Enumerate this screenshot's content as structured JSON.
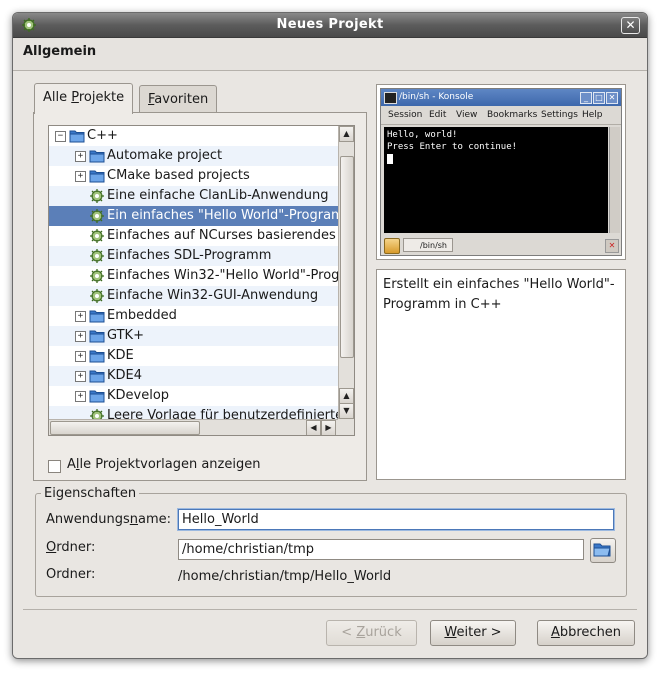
{
  "window": {
    "title": "Neues Projekt"
  },
  "header": {
    "section_title": "Allgemein"
  },
  "tabs": [
    {
      "label_pre": "Alle ",
      "label_key": "P",
      "label_post": "rojekte"
    },
    {
      "label_pre": "",
      "label_key": "F",
      "label_post": "avoriten"
    }
  ],
  "tree": {
    "items": [
      {
        "label": "C++",
        "level": 0,
        "expander": "−",
        "icon": "folder-open-icon"
      },
      {
        "label": "Automake project",
        "level": 1,
        "expander": "+",
        "icon": "folder-icon"
      },
      {
        "label": "CMake based projects",
        "level": 1,
        "expander": "+",
        "icon": "folder-icon"
      },
      {
        "label": "Eine einfache ClanLib-Anwendung",
        "level": 1,
        "expander": "",
        "icon": "gear-icon"
      },
      {
        "label": "Ein einfaches \"Hello World\"-Program",
        "level": 1,
        "expander": "",
        "icon": "gear-icon",
        "selected": true
      },
      {
        "label": "Einfaches auf NCurses basierendes",
        "level": 1,
        "expander": "",
        "icon": "gear-icon"
      },
      {
        "label": "Einfaches SDL-Programm",
        "level": 1,
        "expander": "",
        "icon": "gear-icon"
      },
      {
        "label": "Einfaches Win32-\"Hello World\"-Prog",
        "level": 1,
        "expander": "",
        "icon": "gear-icon"
      },
      {
        "label": "Einfache Win32-GUI-Anwendung",
        "level": 1,
        "expander": "",
        "icon": "gear-icon"
      },
      {
        "label": "Embedded",
        "level": 1,
        "expander": "+",
        "icon": "folder-icon"
      },
      {
        "label": "GTK+",
        "level": 1,
        "expander": "+",
        "icon": "folder-icon"
      },
      {
        "label": "KDE",
        "level": 1,
        "expander": "+",
        "icon": "folder-icon"
      },
      {
        "label": "KDE4",
        "level": 1,
        "expander": "+",
        "icon": "folder-icon"
      },
      {
        "label": "KDevelop",
        "level": 1,
        "expander": "+",
        "icon": "folder-icon"
      },
      {
        "label": "Leere Vorlage für benutzerdefinierte",
        "level": 1,
        "expander": "",
        "icon": "gear-icon"
      }
    ]
  },
  "show_all": {
    "label_pre": "A",
    "label_key": "l",
    "label_post": "le Projektvorlagen anzeigen",
    "checked": false
  },
  "preview": {
    "title": "/bin/sh - Konsole",
    "menu": [
      "Session",
      "Edit",
      "View",
      "Bookmarks",
      "Settings",
      "Help"
    ],
    "terminal_lines": [
      "Hello, world!",
      "Press Enter to continue!"
    ],
    "tab_label": "/bin/sh"
  },
  "description": "Erstellt ein einfaches \"Hello World\"-Programm in C++",
  "properties": {
    "title": "Eigenschaften",
    "app_name_label_pre": "Anwendungs",
    "app_name_label_key": "n",
    "app_name_label_post": "ame:",
    "app_name_value": "Hello_World",
    "folder_label_pre": "",
    "folder_label_key": "O",
    "folder_label_post": "rdner:",
    "folder_value": "/home/christian/tmp",
    "final_folder_label": "Ordner:",
    "final_folder_value": "/home/christian/tmp/Hello_World"
  },
  "buttons": {
    "back_pre": "< ",
    "back_key": "Z",
    "back_post": "urück",
    "next_pre": "",
    "next_key": "W",
    "next_post": "eiter >",
    "cancel_pre": "",
    "cancel_key": "A",
    "cancel_post": "bbrechen"
  }
}
